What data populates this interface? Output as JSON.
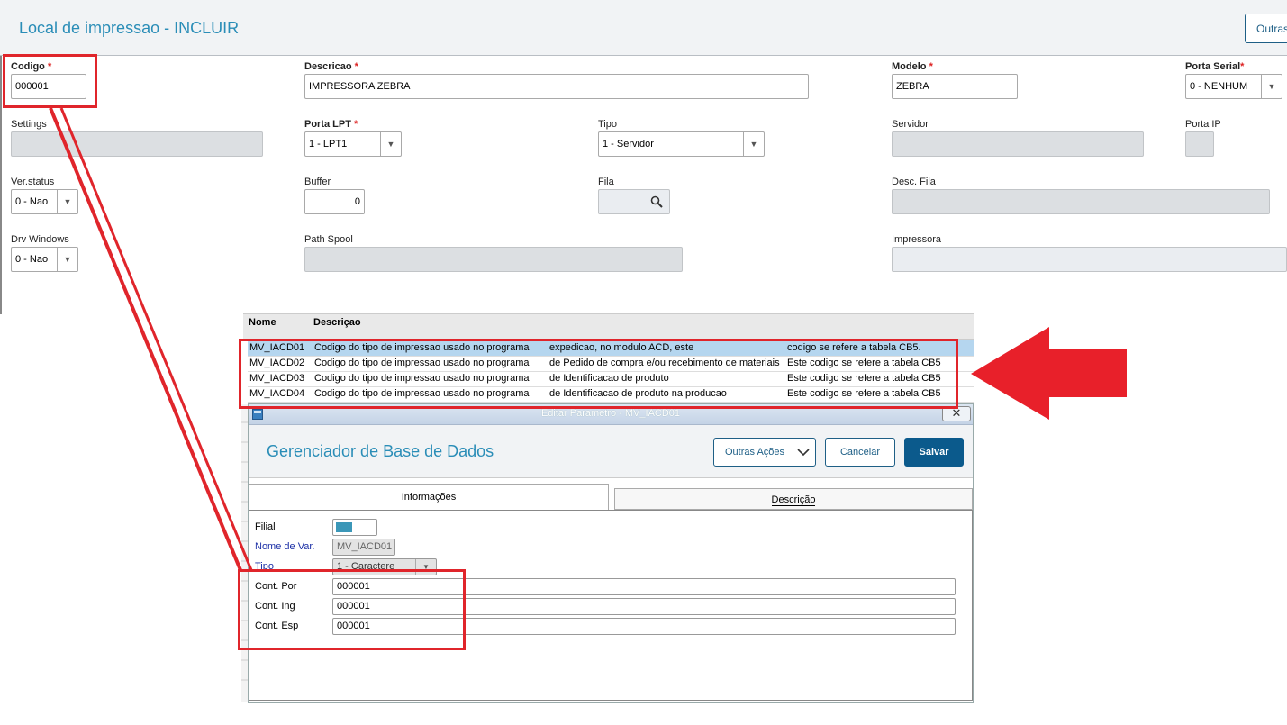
{
  "header": {
    "title": "Local de impressao - INCLUIR",
    "other_button": "Outras"
  },
  "form": {
    "codigo": {
      "label": "Codigo",
      "required": "*",
      "value": "000001"
    },
    "descricao": {
      "label": "Descricao",
      "required": "*",
      "value": "IMPRESSORA ZEBRA"
    },
    "modelo": {
      "label": "Modelo",
      "required": "*",
      "value": "ZEBRA"
    },
    "porta_serial": {
      "label": "Porta Serial",
      "required": "*",
      "value": "0 - NENHUM"
    },
    "settings": {
      "label": "Settings"
    },
    "porta_lpt": {
      "label": "Porta LPT",
      "required": "*",
      "value": "1 - LPT1"
    },
    "tipo": {
      "label": "Tipo",
      "value": "1 - Servidor"
    },
    "servidor": {
      "label": "Servidor"
    },
    "porta_ip": {
      "label": "Porta IP"
    },
    "ver_status": {
      "label": "Ver.status",
      "value": "0 - Nao"
    },
    "buffer": {
      "label": "Buffer",
      "value": "0"
    },
    "fila": {
      "label": "Fila"
    },
    "desc_fila": {
      "label": "Desc. Fila"
    },
    "drv_windows": {
      "label": "Drv Windows",
      "value": "0 - Nao"
    },
    "path_spool": {
      "label": "Path Spool"
    },
    "impressora": {
      "label": "Impressora"
    }
  },
  "grid": {
    "headers": [
      "Nome",
      "Descriçao"
    ],
    "rows": [
      [
        "MV_IACD01",
        "Codigo do tipo de impressao usado no programa",
        "expedicao, no modulo ACD, este",
        "codigo se refere a tabela CB5."
      ],
      [
        "MV_IACD02",
        "Codigo do tipo de impressao usado no programa",
        "de Pedido de compra e/ou recebimento de materiais",
        "Este codigo se refere a tabela CB5"
      ],
      [
        "MV_IACD03",
        "Codigo do tipo de impressao usado no programa",
        "de Identificacao de produto",
        "Este codigo se refere a tabela CB5"
      ],
      [
        "MV_IACD04",
        "Codigo do tipo de impressao usado no programa",
        "de Identificacao de produto na producao",
        "Este codigo se refere a tabela CB5"
      ]
    ]
  },
  "dialog": {
    "window_title": "Editar Parametro - MV_IACD01",
    "heading": "Gerenciador de Base de Dados",
    "buttons": {
      "more": "Outras Ações",
      "cancel": "Cancelar",
      "save": "Salvar"
    },
    "tabs": [
      "Informações",
      "Descrição"
    ],
    "fields": {
      "filial": {
        "label": "Filial"
      },
      "nome_var": {
        "label": "Nome de Var.",
        "value": "MV_IACD01"
      },
      "tipo": {
        "label": "Tipo",
        "value": "1 - Caractere"
      },
      "cont_por": {
        "label": "Cont. Por",
        "value": "000001"
      },
      "cont_ing": {
        "label": "Cont. Ing",
        "value": "000001"
      },
      "cont_esp": {
        "label": "Cont. Esp",
        "value": "000001"
      }
    }
  },
  "colors": {
    "accent": "#2a8db7",
    "primary_button": "#0b5a8c",
    "annotation_red": "#e0252b",
    "selected_row": "#b5d6ef"
  }
}
